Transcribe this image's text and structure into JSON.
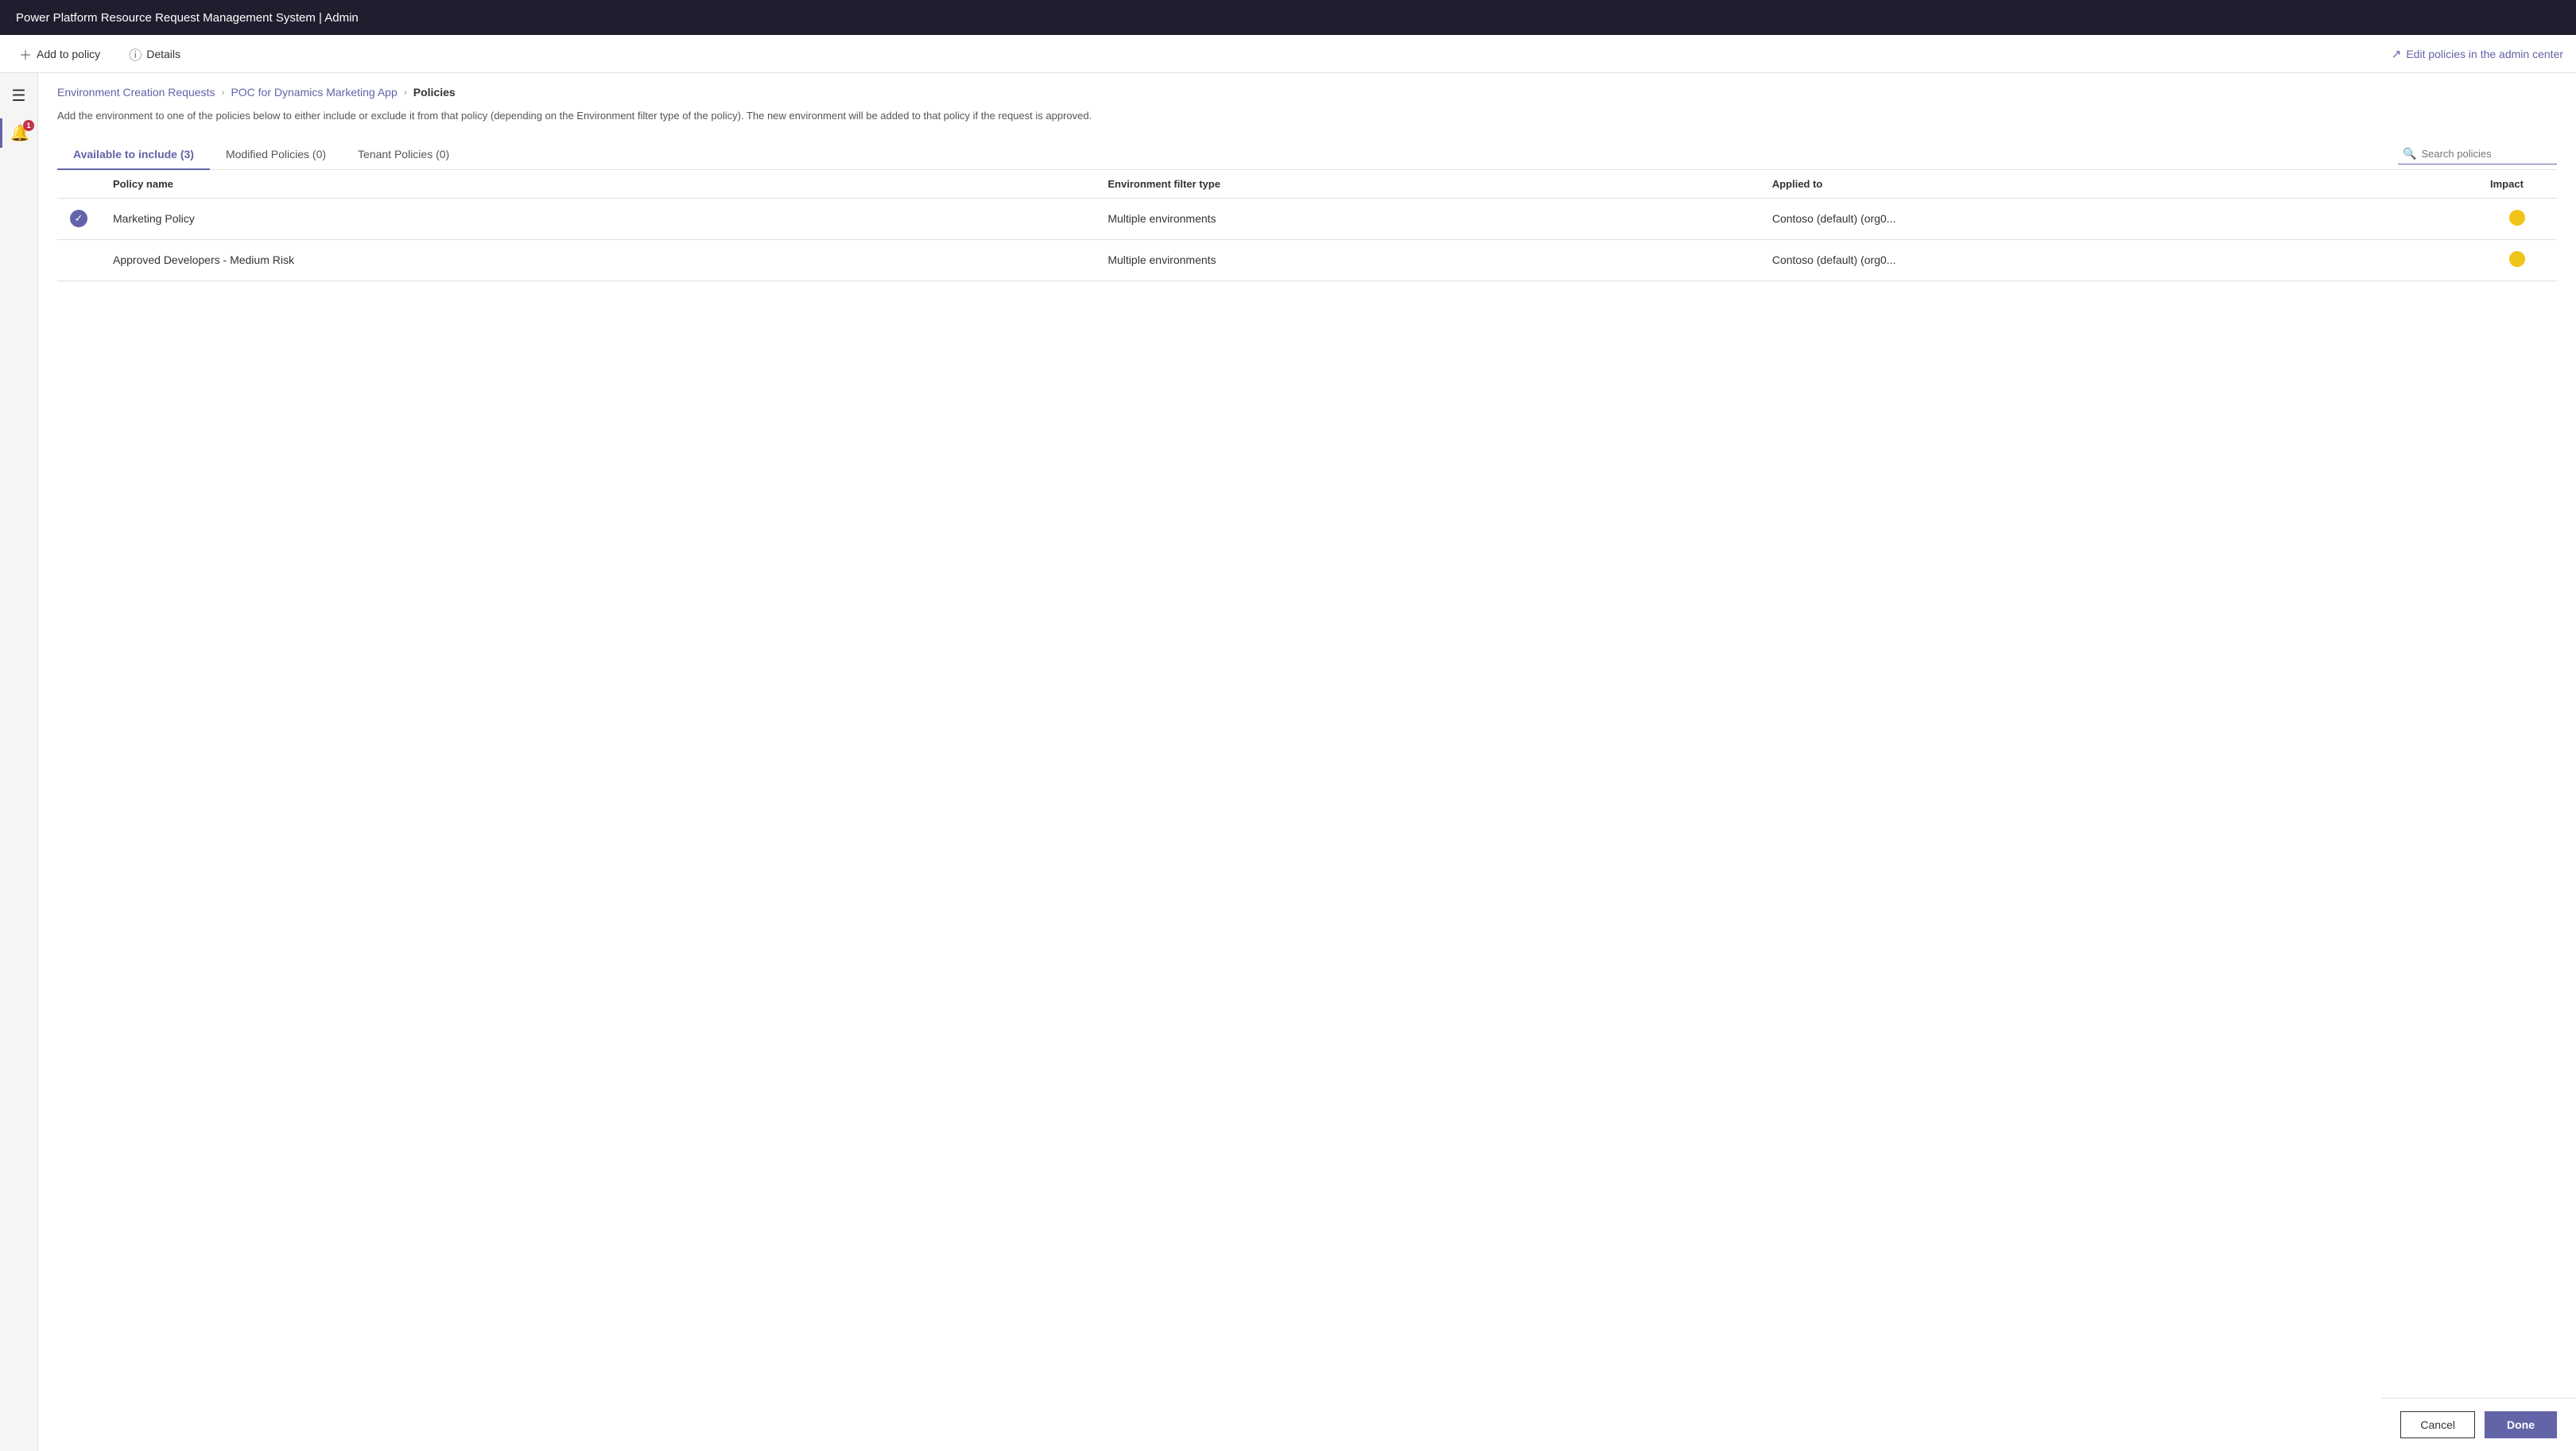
{
  "titleBar": {
    "title": "Power Platform Resource Request Management System | Admin"
  },
  "toolbar": {
    "addToPolicyLabel": "Add to policy",
    "detailsLabel": "Details",
    "editPoliciesLabel": "Edit policies in the admin center"
  },
  "breadcrumb": {
    "step1": "Environment Creation Requests",
    "step2": "POC for Dynamics Marketing App",
    "step3": "Policies"
  },
  "description": "Add the environment to one of the policies below to either include or exclude it from that policy (depending on the Environment filter type of the policy). The new environment will be added to that policy if the request is approved.",
  "tabs": [
    {
      "label": "Available to include (3)",
      "active": true
    },
    {
      "label": "Modified Policies (0)",
      "active": false
    },
    {
      "label": "Tenant Policies (0)",
      "active": false
    }
  ],
  "search": {
    "placeholder": "Search policies"
  },
  "table": {
    "columns": [
      {
        "key": "check",
        "label": ""
      },
      {
        "key": "policyName",
        "label": "Policy name"
      },
      {
        "key": "envFilterType",
        "label": "Environment filter type"
      },
      {
        "key": "appliedTo",
        "label": "Applied to"
      },
      {
        "key": "impact",
        "label": "Impact"
      }
    ],
    "rows": [
      {
        "checked": true,
        "policyName": "Marketing Policy",
        "envFilterType": "Multiple environments",
        "appliedTo": "Contoso (default) (org0...",
        "impact": "medium"
      },
      {
        "checked": false,
        "policyName": "Approved Developers - Medium Risk",
        "envFilterType": "Multiple environments",
        "appliedTo": "Contoso (default) (org0...",
        "impact": "medium"
      }
    ]
  },
  "buttons": {
    "cancel": "Cancel",
    "done": "Done"
  },
  "sidebar": {
    "badgeCount": "1"
  }
}
